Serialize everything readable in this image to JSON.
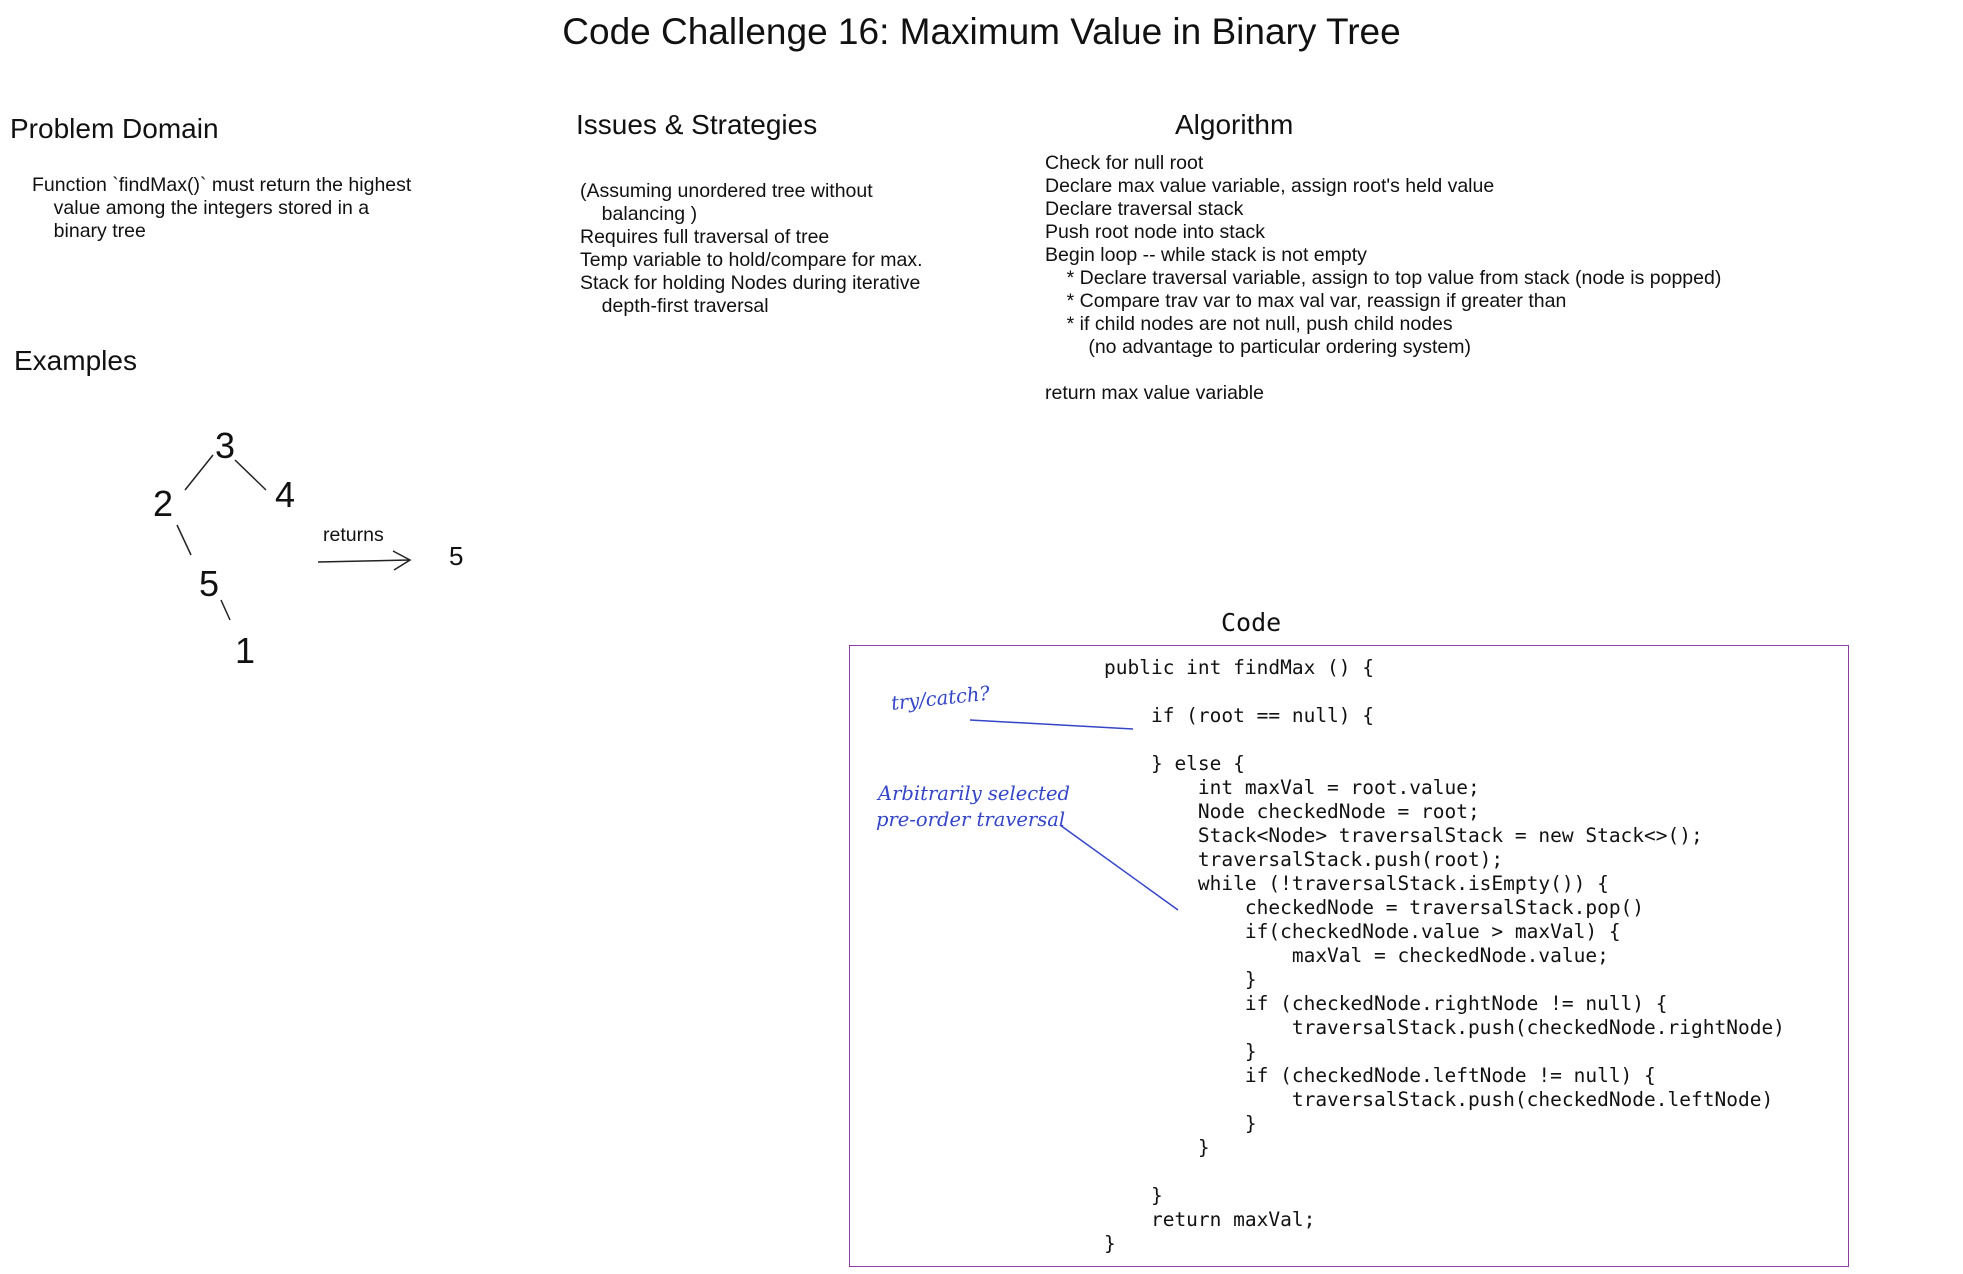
{
  "title": "Code Challenge 16: Maximum Value in Binary Tree",
  "problem_domain": {
    "heading": "Problem Domain",
    "lines": [
      "Function `findMax()` must return the highest",
      "    value among the integers stored in a",
      "    binary tree"
    ]
  },
  "issues": {
    "heading": "Issues & Strategies",
    "lines": [
      "(Assuming unordered tree without",
      "    balancing )",
      "Requires full traversal of tree",
      "Temp variable to hold/compare for max.",
      "Stack for holding Nodes during iterative",
      "    depth-first traversal"
    ]
  },
  "algorithm": {
    "heading": "Algorithm",
    "lines": [
      "Check for null root",
      "Declare max value variable, assign root's held value",
      "Declare traversal stack",
      "Push root node into stack",
      "Begin loop -- while stack is not empty",
      "    * Declare traversal variable, assign to top value from stack (node is popped)",
      "    * Compare trav var to max val var, reassign if greater than",
      "    * if child nodes are not null, push child nodes",
      "        (no advantage to particular ordering system)",
      "",
      "return max value variable"
    ]
  },
  "examples": {
    "heading": "Examples",
    "nodes": [
      "3",
      "2",
      "4",
      "5",
      "1"
    ],
    "arrow_label": "returns",
    "result": "5"
  },
  "code_section": {
    "heading": "Code",
    "lines": [
      "public int findMax () {",
      "",
      "    if (root == null) {",
      "",
      "    } else {",
      "        int maxVal = root.value;",
      "        Node checkedNode = root;",
      "        Stack<Node> traversalStack = new Stack<>();",
      "        traversalStack.push(root);",
      "        while (!traversalStack.isEmpty()) {",
      "            checkedNode = traversalStack.pop()",
      "            if(checkedNode.value > maxVal) {",
      "                maxVal = checkedNode.value;",
      "            }",
      "            if (checkedNode.rightNode != null) {",
      "                traversalStack.push(checkedNode.rightNode)",
      "            }",
      "            if (checkedNode.leftNode != null) {",
      "                traversalStack.push(checkedNode.leftNode)",
      "            }",
      "        }",
      "",
      "    }",
      "    return maxVal;",
      "}"
    ],
    "annotations": {
      "try_catch": "try/catch?",
      "arbitrary_1": "Arbitrarily selected",
      "arbitrary_2": "pre-order traversal"
    }
  },
  "colors": {
    "code_border": "#8e3ea8",
    "annotation_ink": "#3445c8",
    "text": "#111111"
  }
}
